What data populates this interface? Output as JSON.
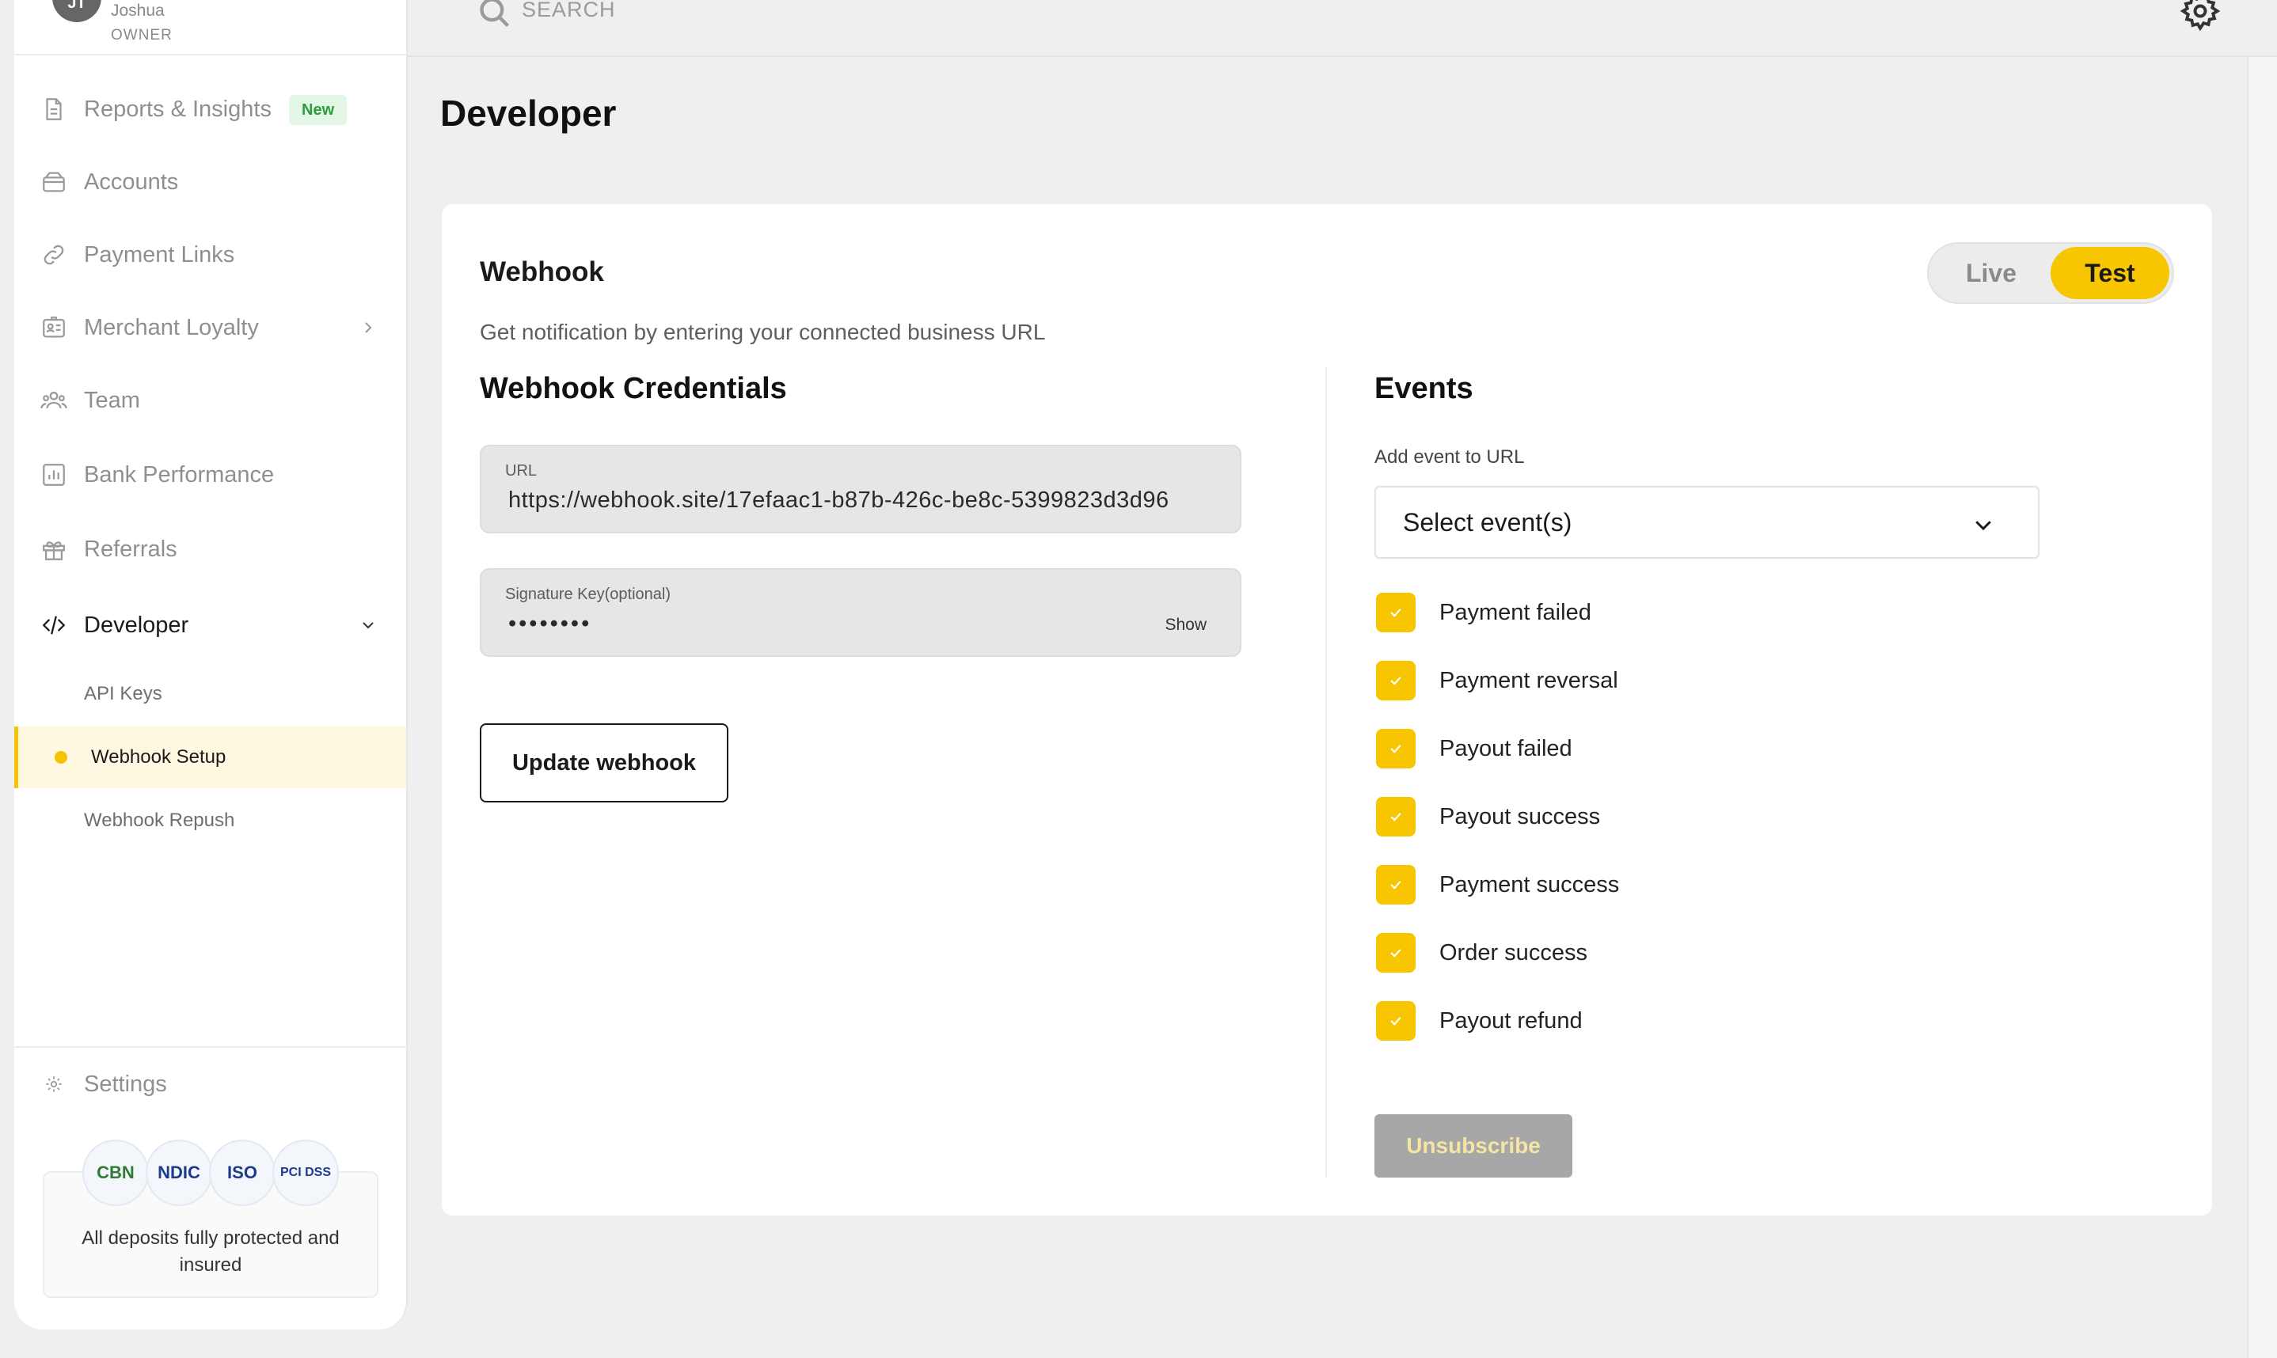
{
  "user": {
    "initials": "JT",
    "name": "Joshua",
    "role": "OWNER"
  },
  "search": {
    "placeholder": "SEARCH"
  },
  "sidebar": {
    "items": [
      {
        "label": "Reports & Insights",
        "badge": "New",
        "icon": "document-icon"
      },
      {
        "label": "Accounts",
        "icon": "wallet-icon"
      },
      {
        "label": "Payment Links",
        "icon": "link-icon"
      },
      {
        "label": "Merchant Loyalty",
        "icon": "id-card-icon"
      },
      {
        "label": "Team",
        "icon": "people-icon"
      },
      {
        "label": "Bank Performance",
        "icon": "bar-chart-icon"
      },
      {
        "label": "Referrals",
        "icon": "gift-icon"
      },
      {
        "label": "Developer",
        "icon": "code-icon"
      }
    ],
    "developer_sub": [
      {
        "label": "API Keys"
      },
      {
        "label": "Webhook Setup"
      },
      {
        "label": "Webhook Repush"
      }
    ],
    "settings_label": "Settings",
    "trust": {
      "logos": [
        "CBN",
        "NDIC",
        "ISO",
        "PCI DSS"
      ],
      "text": "All deposits fully protected and insured"
    }
  },
  "page": {
    "title": "Developer"
  },
  "webhook": {
    "title": "Webhook",
    "description": "Get notification by entering your connected business URL",
    "env_options": [
      "Live",
      "Test"
    ],
    "env_selected": "Test",
    "credentials_title": "Webhook Credentials",
    "url_label": "URL",
    "url_value": "https://webhook.site/17efaac1-b87b-426c-be8c-5399823d3d96",
    "signature_label": "Signature Key(optional)",
    "signature_value": "••••••••",
    "show_label": "Show",
    "update_button": "Update webhook"
  },
  "events": {
    "title": "Events",
    "add_label": "Add event to URL",
    "select_placeholder": "Select event(s)",
    "items": [
      {
        "label": "Payment failed",
        "checked": true
      },
      {
        "label": "Payment reversal",
        "checked": true
      },
      {
        "label": "Payout failed",
        "checked": true
      },
      {
        "label": "Payout success",
        "checked": true
      },
      {
        "label": "Payment success",
        "checked": true
      },
      {
        "label": "Order success",
        "checked": true
      },
      {
        "label": "Payout refund",
        "checked": true
      }
    ],
    "unsubscribe_button": "Unsubscribe"
  },
  "colors": {
    "accent": "#f7c600",
    "new_badge": "#2a9d3c",
    "active_bg": "#fff8e1"
  }
}
